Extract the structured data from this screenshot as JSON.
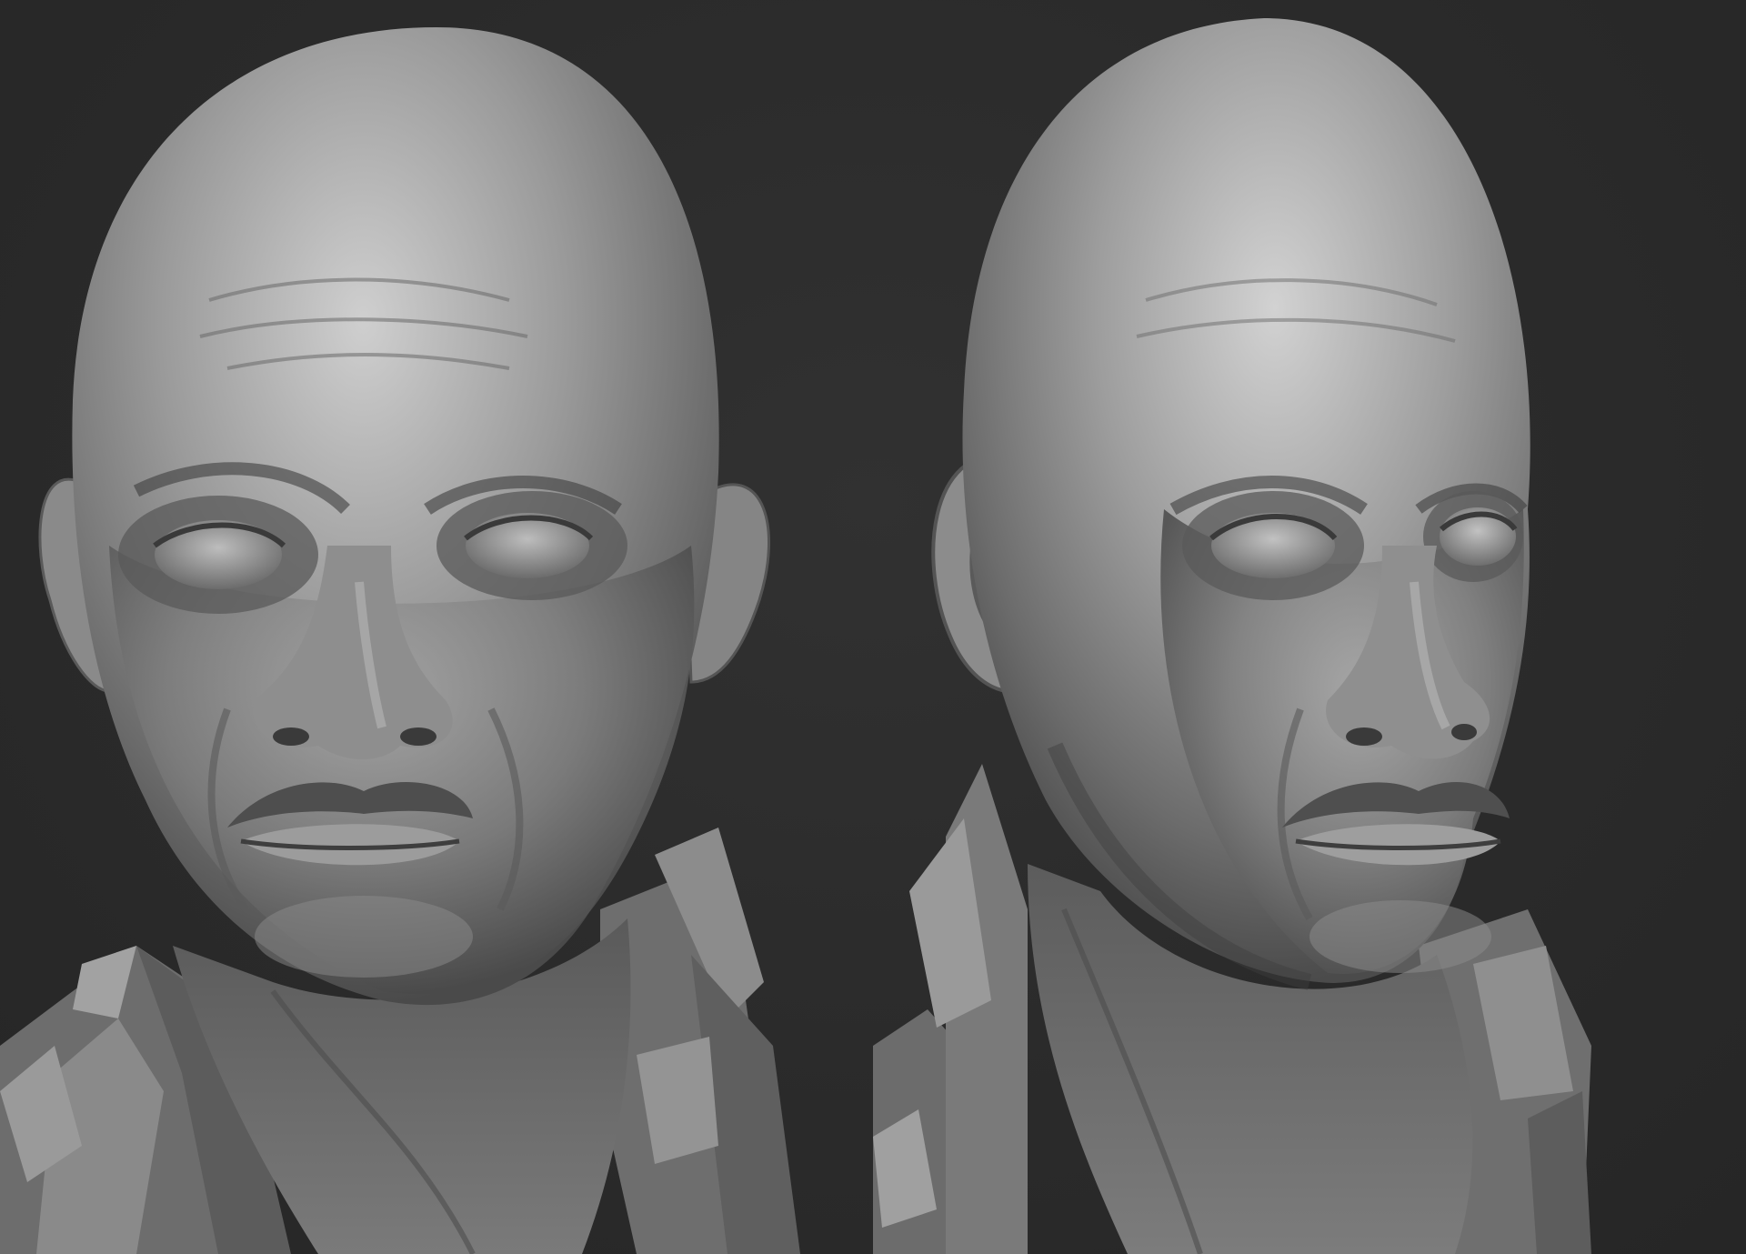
{
  "scene": {
    "background_color": "#2b2b2b",
    "clay_color": "#8a8a8a",
    "clay_highlight": "#c9c9c9",
    "clay_shadow": "#3a3a3a"
  },
  "renders": [
    {
      "view": "front-three-quarter-left"
    },
    {
      "view": "three-quarter-right"
    }
  ]
}
